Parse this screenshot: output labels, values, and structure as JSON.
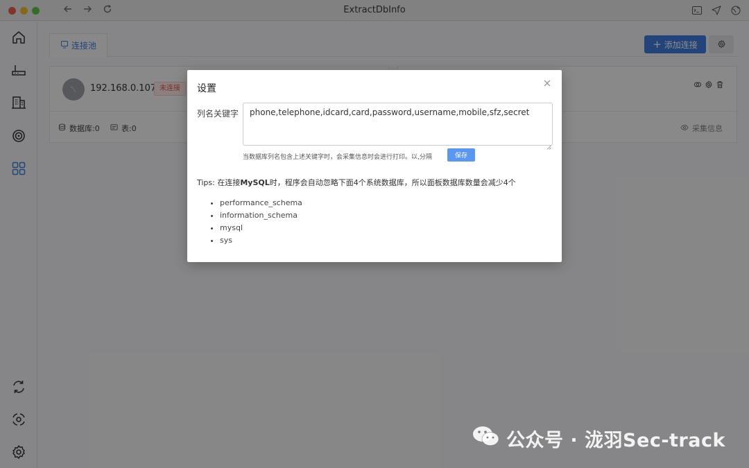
{
  "window": {
    "title": "ExtractDbInfo"
  },
  "titlebar": {
    "icons": [
      "back-arrow-icon",
      "forward-arrow-icon",
      "reload-icon",
      "terminal-icon",
      "send-icon",
      "globe-icon"
    ]
  },
  "sidebar": {
    "top_items": [
      "home-icon",
      "router-icon",
      "building-icon",
      "target-icon",
      "grid-icon"
    ],
    "bottom_items": [
      "sync-icon",
      "scan-icon",
      "settings-icon"
    ],
    "accent": "#3b7fe0"
  },
  "main": {
    "tabs": [
      {
        "label": "连接池"
      }
    ],
    "add_button": "添加连接",
    "connection": {
      "host": "192.168.0.107",
      "status": "未连接",
      "db_label": "数据库:0",
      "table_label": "表:0",
      "collect_label": "采集信息"
    }
  },
  "modal": {
    "title": "设置",
    "field_label": "列名关键字",
    "keywords_value": "phone,telephone,idcard,card,password,username,mobile,sfz,secret",
    "hint": "当数据库列名包含上述关键字时，会采集信息时会进行打印。以,分隔",
    "save_label": "保存",
    "tips_prefix": "Tips: 在连接",
    "tips_bold": "MySQL",
    "tips_suffix": "时，程序会自动忽略下面4个系统数据库，所以面板数据库数量会减少4个",
    "ignored_dbs": [
      "performance_schema",
      "information_schema",
      "mysql",
      "sys"
    ]
  },
  "watermark": {
    "text": "公众号 · 泷羽Sec-track"
  }
}
